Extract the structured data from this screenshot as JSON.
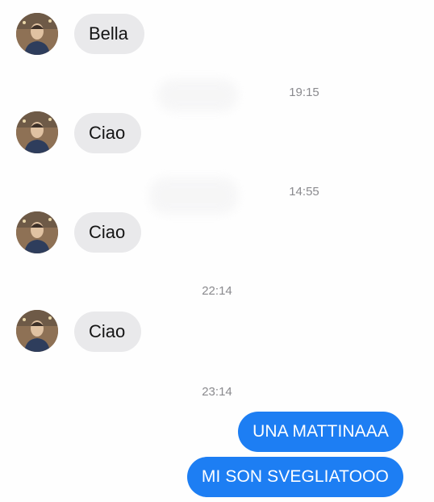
{
  "conversation": {
    "messages": [
      {
        "text": "Bella"
      },
      {
        "time": "19:15"
      },
      {
        "text": "Ciao"
      },
      {
        "time": "14:55"
      },
      {
        "text": "Ciao"
      },
      {
        "time": "22:14"
      },
      {
        "text": "Ciao"
      },
      {
        "time": "23:14"
      },
      {
        "text": "UNA MATTINAAA"
      },
      {
        "text": "MI SON SVEGLIATOOO"
      }
    ]
  },
  "icons": {
    "contact_avatar": "user-avatar-photo"
  },
  "colors": {
    "incoming_bubble": "#e9e9eb",
    "outgoing_bubble": "#1d7ef3",
    "timestamp_text": "#8a8a8e"
  }
}
